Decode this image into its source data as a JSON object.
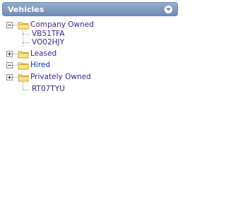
{
  "header": {
    "title": "Vehicles",
    "collapse_icon": "chevron-down-icon"
  },
  "tree": {
    "groups": [
      {
        "label": "Company Owned",
        "expanded": true,
        "children": [
          "VB51TFA",
          "VO02HJY"
        ]
      },
      {
        "label": "Leased",
        "expanded": false,
        "children": []
      },
      {
        "label": "Hired",
        "expanded": false,
        "selected": true,
        "children": []
      },
      {
        "label": "Privately Owned",
        "expanded": true,
        "children": [
          "RT07TYU"
        ]
      }
    ]
  },
  "colors": {
    "header_top": "#96acc9",
    "header_bottom": "#6f8db5",
    "tree_text": "#3a1f8a",
    "selected_text": "#0033cc",
    "folder_fill": "#ffe28a",
    "folder_stroke": "#c9a227"
  }
}
